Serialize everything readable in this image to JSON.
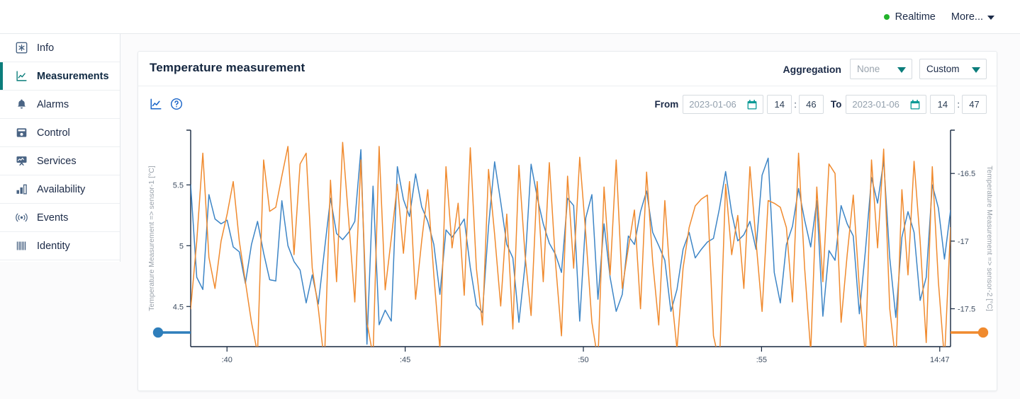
{
  "header": {
    "realtime_label": "Realtime",
    "realtime_dot_color": "#22b32b",
    "more_label": "More...",
    "more_icon": "chevron-down-icon"
  },
  "sidebar": {
    "items": [
      {
        "label": "Info",
        "icon": "asterisk-icon",
        "active": false
      },
      {
        "label": "Measurements",
        "icon": "line-chart-icon",
        "active": true
      },
      {
        "label": "Alarms",
        "icon": "bell-icon",
        "active": false
      },
      {
        "label": "Control",
        "icon": "device-icon",
        "active": false
      },
      {
        "label": "Services",
        "icon": "presentation-icon",
        "active": false
      },
      {
        "label": "Availability",
        "icon": "bar-chart-icon",
        "active": false
      },
      {
        "label": "Events",
        "icon": "broadcast-icon",
        "active": false
      },
      {
        "label": "Identity",
        "icon": "barcode-icon",
        "active": false
      }
    ],
    "active_accent": "#0b7d7b"
  },
  "card": {
    "title": "Temperature measurement",
    "aggregation": {
      "label": "Aggregation",
      "select_value": "None",
      "select_placeholder": "None",
      "range_value": "Custom",
      "caret_icon": "chevron-down-icon"
    },
    "toolbar": {
      "chart_icon": "line-chart-icon",
      "help_icon": "question-circle-icon"
    },
    "range": {
      "from_label": "From",
      "from_date": "2023-01-06",
      "from_hour": "14",
      "from_minute": "46",
      "to_label": "To",
      "to_date": "2023-01-06",
      "to_hour": "14",
      "to_minute": "47",
      "time_separator": ":",
      "calendar_icon": "calendar-icon"
    }
  },
  "chart_data": {
    "type": "line",
    "title": "Temperature measurement",
    "xlabel": "",
    "ylabel": "Temperature Measurement => sensor-1 [°C]",
    "y2label": "Temperature Measurement => sensor-2 [°C]",
    "x_tick_labels": [
      ":40",
      ":45",
      ":50",
      ":55",
      "14:47"
    ],
    "x_tick_positions": [
      0.0478,
      0.2823,
      0.5168,
      0.7513,
      0.9858
    ],
    "ylim": [
      4.17,
      5.95
    ],
    "y_ticks": [
      4.5,
      5,
      5.5
    ],
    "y2lim": [
      -17.78,
      -16.18
    ],
    "y2_ticks": [
      -16.5,
      -17,
      -17.5
    ],
    "grid": false,
    "legend": "none",
    "series": [
      {
        "name": "Temperature Measurement => sensor-1 [°C]",
        "color": "#3d85c6",
        "axis": "left",
        "values": [
          5.5,
          4.74,
          4.64,
          5.42,
          5.22,
          5.18,
          5.21,
          4.99,
          4.95,
          4.69,
          5.01,
          5.2,
          4.94,
          4.72,
          4.71,
          5.37,
          5.0,
          4.87,
          4.8,
          4.53,
          4.76,
          4.52,
          4.96,
          5.39,
          5.1,
          5.05,
          5.11,
          5.2,
          5.79,
          4.19,
          5.49,
          4.35,
          4.47,
          4.38,
          5.65,
          5.38,
          5.24,
          5.59,
          5.32,
          5.2,
          5.01,
          4.6,
          5.13,
          5.07,
          5.14,
          5.22,
          4.82,
          4.51,
          4.45,
          5.16,
          5.69,
          5.36,
          5.01,
          4.9,
          4.37,
          4.84,
          5.67,
          5.4,
          5.18,
          5.02,
          4.93,
          4.78,
          5.39,
          5.33,
          4.38,
          5.23,
          5.42,
          4.56,
          5.18,
          4.74,
          4.46,
          4.6,
          5.08,
          5.01,
          5.28,
          5.45,
          5.11,
          5.0,
          4.88,
          4.46,
          4.64,
          4.97,
          5.11,
          4.9,
          4.97,
          5.03,
          5.06,
          5.31,
          5.61,
          5.27,
          5.04,
          5.09,
          5.2,
          4.97,
          5.58,
          5.72,
          4.78,
          4.53,
          5.01,
          5.16,
          5.47,
          5.21,
          4.99,
          5.37,
          4.42,
          4.96,
          4.88,
          5.33,
          5.18,
          5.08,
          4.44,
          4.96,
          5.56,
          5.35,
          5.7,
          4.9,
          4.41,
          5.07,
          5.28,
          5.11,
          4.55,
          4.74,
          5.5,
          5.31,
          4.89,
          5.29
        ]
      },
      {
        "name": "Temperature Measurement => sensor-2 [°C]",
        "color": "#f08a2e",
        "axis": "right",
        "values": [
          -17.5,
          -17.0,
          -16.35,
          -17.12,
          -17.35,
          -17.0,
          -16.8,
          -16.56,
          -17.0,
          -17.3,
          -17.6,
          -17.83,
          -16.4,
          -16.78,
          -16.75,
          -16.52,
          -16.3,
          -17.1,
          -16.43,
          -16.35,
          -17.2,
          -17.5,
          -17.9,
          -16.55,
          -17.3,
          -16.27,
          -16.85,
          -17.45,
          -16.4,
          -17.6,
          -17.85,
          -16.3,
          -17.36,
          -16.98,
          -16.58,
          -17.09,
          -16.56,
          -17.43,
          -17.0,
          -16.62,
          -17.25,
          -17.8,
          -16.45,
          -17.05,
          -16.72,
          -17.4,
          -16.31,
          -17.2,
          -17.62,
          -16.47,
          -16.95,
          -17.48,
          -16.8,
          -17.65,
          -16.44,
          -17.1,
          -17.55,
          -16.56,
          -17.3,
          -16.42,
          -17.15,
          -17.7,
          -16.52,
          -17.2,
          -16.38,
          -16.95,
          -17.6,
          -17.88,
          -16.6,
          -17.25,
          -16.4,
          -17.35,
          -17.05,
          -16.77,
          -17.5,
          -16.49,
          -17.15,
          -17.62,
          -16.7,
          -17.35,
          -17.8,
          -17.2,
          -16.9,
          -16.74,
          -16.69,
          -16.66,
          -17.7,
          -17.9,
          -16.58,
          -17.1,
          -16.81,
          -17.35,
          -16.45,
          -17.0,
          -17.52,
          -16.7,
          -16.72,
          -16.75,
          -16.9,
          -17.45,
          -16.35,
          -17.2,
          -17.82,
          -16.6,
          -17.3,
          -16.43,
          -16.5,
          -17.6,
          -17.1,
          -16.66,
          -17.35,
          -17.85,
          -16.4,
          -17.05,
          -16.32,
          -17.5,
          -17.9,
          -16.62,
          -17.25,
          -16.41,
          -17.0,
          -17.75,
          -16.45,
          -17.3,
          -17.88,
          -16.9
        ]
      }
    ],
    "range_slider": {
      "left_handle_color": "#2e7ebb",
      "right_handle_color": "#f08a2e"
    }
  }
}
